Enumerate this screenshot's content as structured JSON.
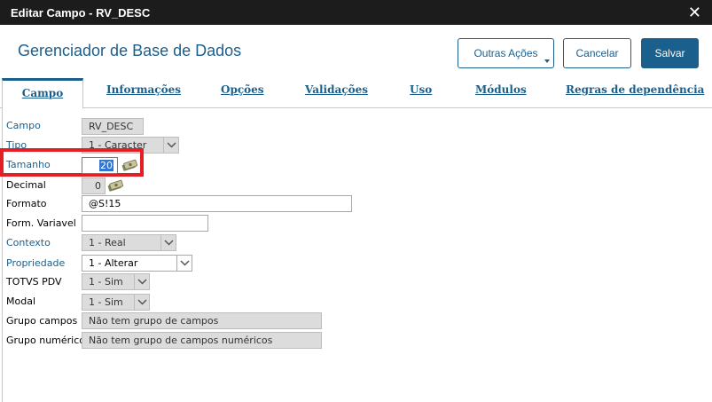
{
  "window": {
    "title": "Editar Campo - RV_DESC",
    "close_glyph": "✕"
  },
  "header": {
    "title": "Gerenciador de Base de Dados",
    "buttons": {
      "other_actions": "Outras Ações",
      "cancel": "Cancelar",
      "save": "Salvar"
    }
  },
  "tabs": [
    {
      "label": "Campo",
      "active": true
    },
    {
      "label": "Informações"
    },
    {
      "label": "Opções"
    },
    {
      "label": "Validações"
    },
    {
      "label": "Uso"
    },
    {
      "label": "Módulos"
    },
    {
      "label": "Regras de dependência"
    }
  ],
  "form": {
    "campo": {
      "label": "Campo",
      "value": "RV_DESC"
    },
    "tipo": {
      "label": "Tipo",
      "value": "1 - Caracter"
    },
    "tamanho": {
      "label": "Tamanho",
      "value": "20"
    },
    "decimal": {
      "label": "Decimal",
      "value": "0"
    },
    "formato": {
      "label": "Formato",
      "value": "@S!15"
    },
    "form_variavel": {
      "label": "Form. Variavel",
      "value": ""
    },
    "contexto": {
      "label": "Contexto",
      "value": "1 - Real"
    },
    "propriedade": {
      "label": "Propriedade",
      "value": "1 - Alterar"
    },
    "totvs_pdv": {
      "label": "TOTVS PDV",
      "value": "1 - Sim"
    },
    "modal": {
      "label": "Modal",
      "value": "1 - Sim"
    },
    "grupo_campos": {
      "label": "Grupo campos",
      "value": "Não tem grupo de campos"
    },
    "grupo_numerico": {
      "label": "Grupo numérico",
      "value": "Não tem grupo de campos numéricos"
    }
  },
  "colors": {
    "accent": "#1b5f8c",
    "highlight": "#e41e25",
    "titlebar": "#1c1c1c"
  }
}
